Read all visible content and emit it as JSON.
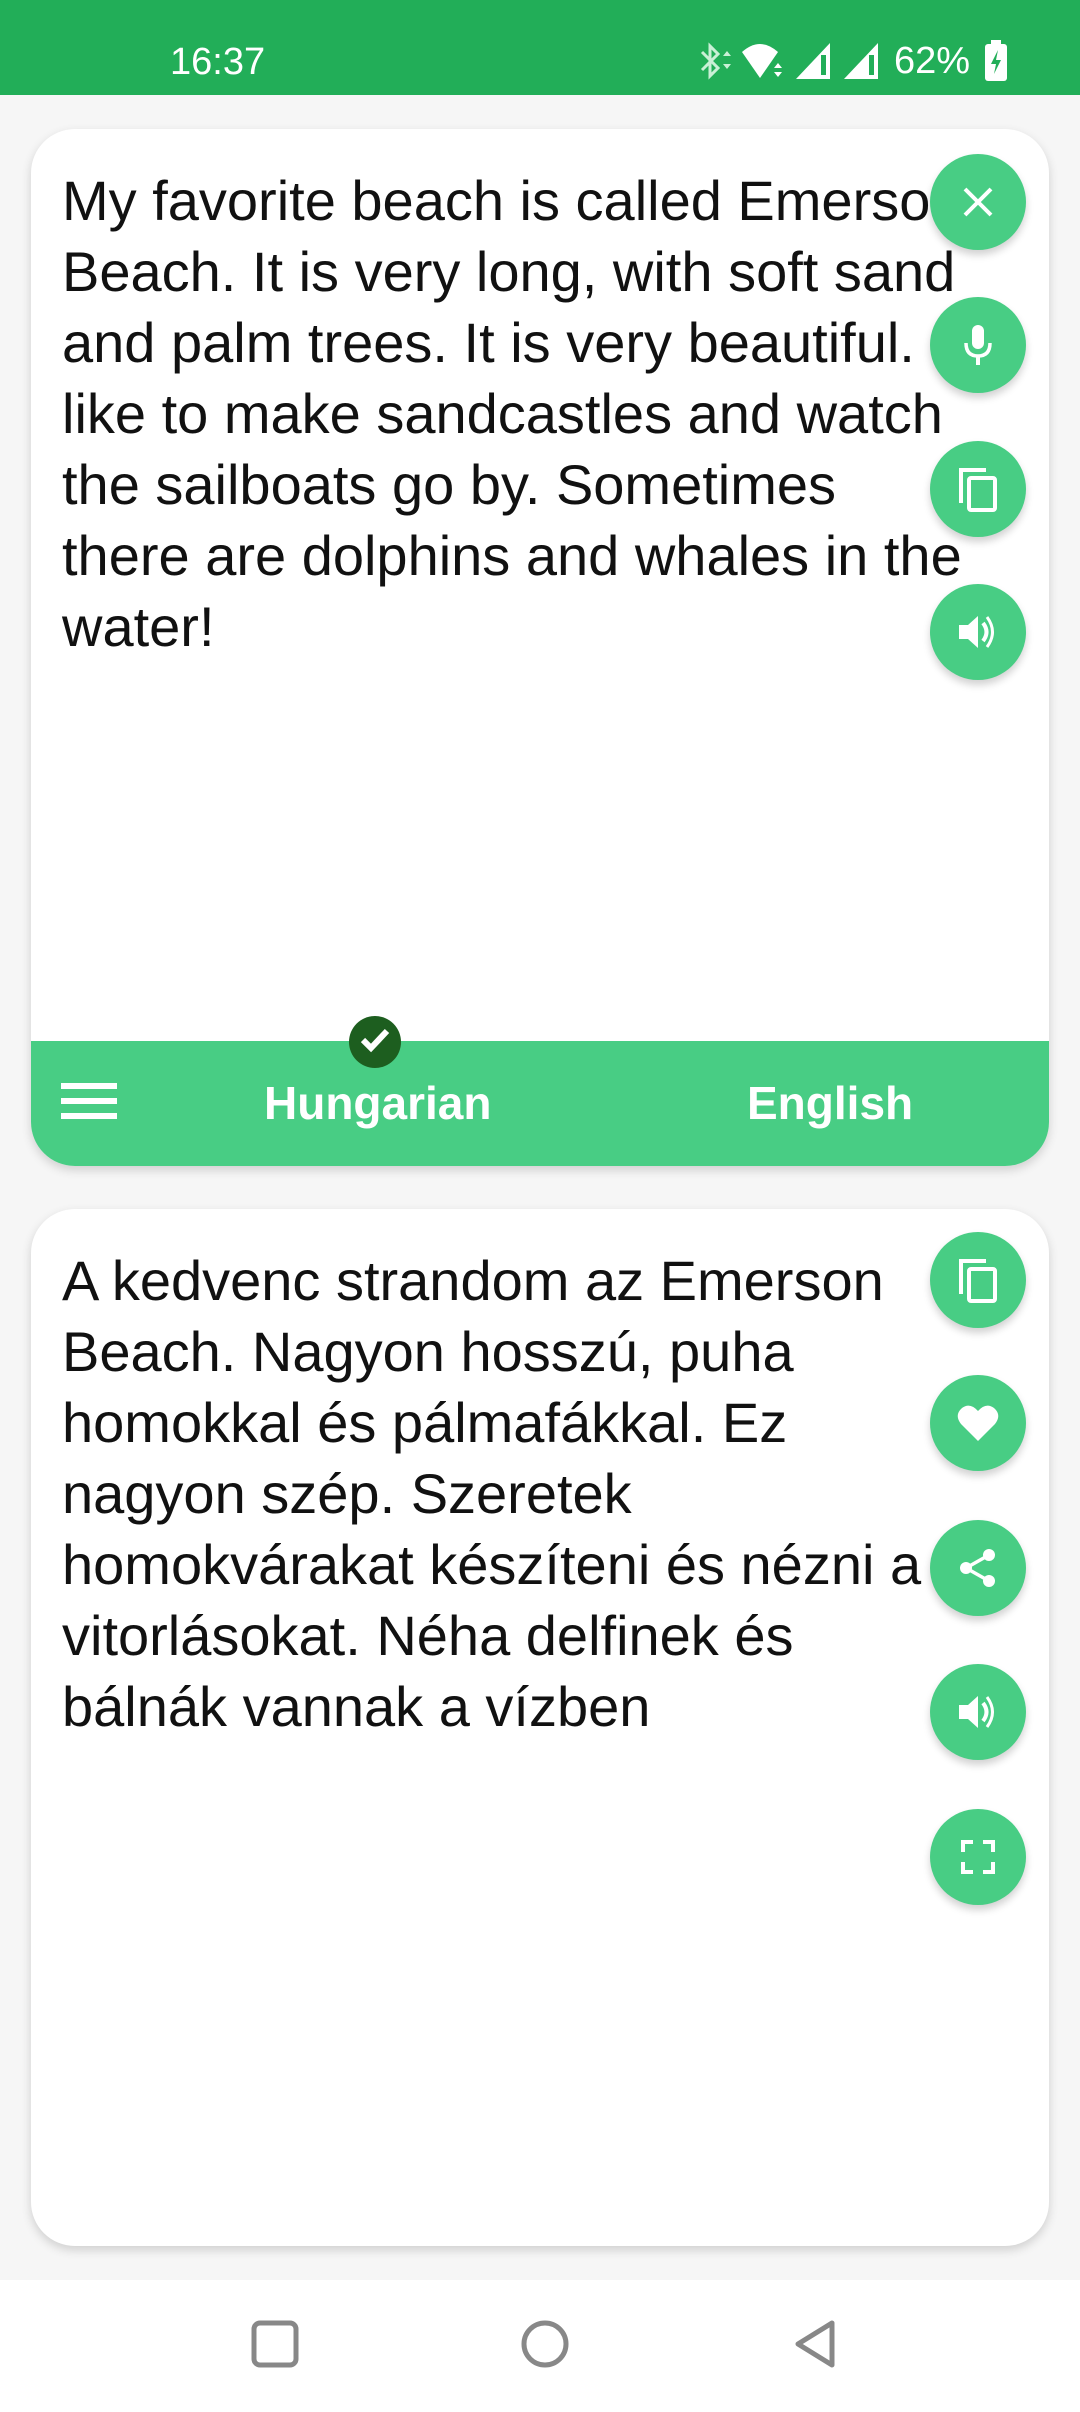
{
  "status_bar": {
    "time": "16:37",
    "battery_percent": "62%",
    "icons": [
      "bluetooth-icon",
      "wifi-icon",
      "signal-icon",
      "signal-icon",
      "battery-charging-icon"
    ],
    "background_color": "#22ae58"
  },
  "source_card": {
    "text": "My favorite beach is called Emerson Beach. It is very long, with soft sand and palm trees. It is very beautiful. I like to make sandcastles and watch the sailboats go by. Sometimes there are dolphins and whales in the water!",
    "buttons": [
      {
        "name": "clear",
        "icon": "close-icon"
      },
      {
        "name": "voice-input",
        "icon": "microphone-icon"
      },
      {
        "name": "copy",
        "icon": "copy-icon"
      },
      {
        "name": "speak",
        "icon": "speaker-icon"
      }
    ]
  },
  "language_bar": {
    "source_language": "Hungarian",
    "target_language": "English",
    "selected": "Hungarian",
    "menu_icon": "hamburger-menu-icon",
    "accent_color": "#48cd84"
  },
  "target_card": {
    "text": "A kedvenc strandom az Emerson Beach. Nagyon hosszú, puha homokkal és pálmafákkal. Ez nagyon szép. Szeretek homokvárakat készíteni és nézni a vitorlásokat. Néha delfinek és bálnák vannak a vízben",
    "buttons": [
      {
        "name": "copy",
        "icon": "copy-icon"
      },
      {
        "name": "favorite",
        "icon": "heart-icon"
      },
      {
        "name": "share",
        "icon": "share-icon"
      },
      {
        "name": "speak",
        "icon": "speaker-icon"
      },
      {
        "name": "fullscreen",
        "icon": "fullscreen-icon"
      }
    ]
  },
  "nav_bar": {
    "buttons": [
      "recents",
      "home",
      "back"
    ]
  }
}
